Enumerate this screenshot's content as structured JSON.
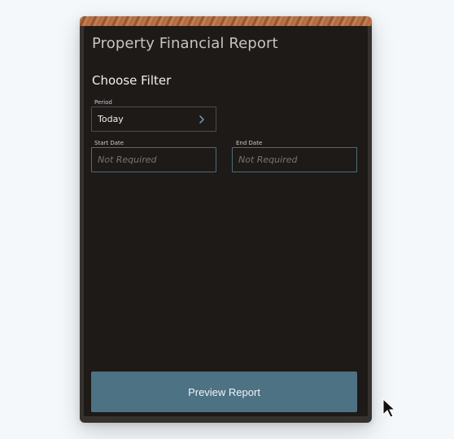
{
  "window": {
    "title": "Property Financial Report"
  },
  "filter": {
    "heading": "Choose Filter",
    "period": {
      "label": "Period",
      "value": "Today",
      "icon": "chevron-right-icon"
    },
    "start_date": {
      "label": "Start Date",
      "placeholder": "Not Required"
    },
    "end_date": {
      "label": "End Date",
      "placeholder": "Not Required"
    }
  },
  "actions": {
    "preview_label": "Preview Report"
  },
  "colors": {
    "background": "#f4f8fb",
    "screen": "#1d1a18",
    "button": "#4c7284",
    "title_text": "#c8c3bf"
  }
}
